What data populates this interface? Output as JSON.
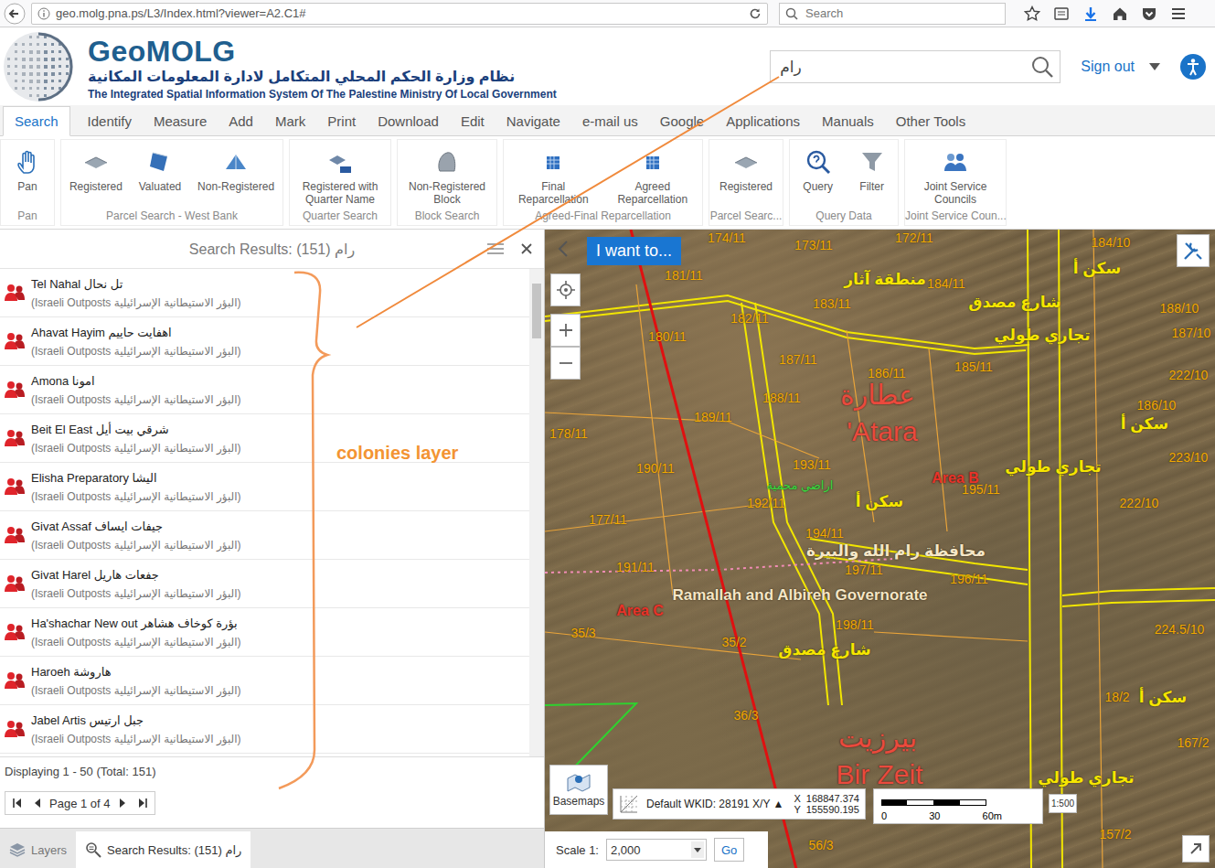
{
  "browser": {
    "url": "geo.molg.pna.ps/L3/Index.html?viewer=A2.C1#",
    "search_placeholder": "Search"
  },
  "header": {
    "logo_title": "GeoMOLG",
    "subtitle_ar": "نظام وزارة الحكم المحلي المتكامل لادارة المعلومات المكانية",
    "subtitle_en": "The Integrated Spatial Information System Of The Palestine Ministry Of Local Government",
    "search_value": "رام",
    "sign_out": "Sign out"
  },
  "tabs": [
    {
      "label": "Search",
      "selected": true
    },
    {
      "label": "Identify",
      "selected": false
    },
    {
      "label": "Measure",
      "selected": false
    },
    {
      "label": "Add",
      "selected": false
    },
    {
      "label": "Mark",
      "selected": false
    },
    {
      "label": "Print",
      "selected": false
    },
    {
      "label": "Download",
      "selected": false
    },
    {
      "label": "Edit",
      "selected": false
    },
    {
      "label": "Navigate",
      "selected": false
    },
    {
      "label": "e-mail us",
      "selected": false
    },
    {
      "label": "Google",
      "selected": false
    },
    {
      "label": "Applications",
      "selected": false
    },
    {
      "label": "Manuals",
      "selected": false
    },
    {
      "label": "Other Tools",
      "selected": false
    }
  ],
  "ribbon": [
    {
      "label": "Pan",
      "buttons": [
        "Pan"
      ]
    },
    {
      "label": "Parcel Search - West Bank",
      "buttons": [
        "Registered",
        "Valuated",
        "Non-Registered"
      ]
    },
    {
      "label": "Quarter Search",
      "buttons": [
        "Registered with Quarter Name"
      ]
    },
    {
      "label": "Block Search",
      "buttons": [
        "Non-Registered Block"
      ]
    },
    {
      "label": "Agreed-Final Reparcellation",
      "buttons": [
        "Final Reparcellation",
        "Agreed Reparcellation"
      ]
    },
    {
      "label": "Parcel Searc...",
      "buttons": [
        "Registered"
      ]
    },
    {
      "label": "Query Data",
      "buttons": [
        "Query",
        "Filter"
      ]
    },
    {
      "label": "Joint Service Coun...",
      "buttons": [
        "Joint Service Councils"
      ]
    }
  ],
  "results": {
    "title": "Search Results: (151) رام",
    "items": [
      {
        "name": "Tel Nahal تل نحال",
        "subtitle": "(Israeli Outposts   البؤر الاستيطانية الإسرائيلية)"
      },
      {
        "name": "Ahavat Hayim اهفايت حاييم",
        "subtitle": "(Israeli Outposts   البؤر الاستيطانية الإسرائيلية)"
      },
      {
        "name": "Amona امونا",
        "subtitle": "(Israeli Outposts   البؤر الاستيطانية الإسرائيلية)"
      },
      {
        "name": "Beit El East شرقي بيت أيل",
        "subtitle": "(Israeli Outposts   البؤر الاستيطانية الإسرائيلية)"
      },
      {
        "name": "Elisha Preparatory اليشا",
        "subtitle": "(Israeli Outposts   البؤر الاستيطانية الإسرائيلية)"
      },
      {
        "name": "Givat Assaf جيفات ايساف",
        "subtitle": "(Israeli Outposts   البؤر الاستيطانية الإسرائيلية)"
      },
      {
        "name": "Givat Harel جفعات هاريل",
        "subtitle": "(Israeli Outposts   البؤر الاستيطانية الإسرائيلية)"
      },
      {
        "name": "Ha'shachar New out بؤرة كوخاف هشاهر",
        "subtitle": "(Israeli Outposts   البؤر الاستيطانية الإسرائيلية)"
      },
      {
        "name": "Haroeh هاروشة",
        "subtitle": "(Israeli Outposts   البؤر الاستيطانية الإسرائيلية)"
      },
      {
        "name": "Jabel Artis جبل ارتيس",
        "subtitle": "(Israeli Outposts   البؤر الاستيطانية الإسرائيلية)"
      }
    ],
    "displaying": "Displaying 1 - 50 (Total: 151)",
    "page": "Page 1 of 4"
  },
  "bottom_tabs": [
    {
      "label": "Layers",
      "selected": false
    },
    {
      "label": "Search Results: (151) رام",
      "selected": true
    }
  ],
  "annotation": {
    "text": "colonies layer"
  },
  "map": {
    "i_want_to": "I want to...",
    "basemaps": "Basemaps",
    "wkid": "Default WKID: 28191 X/Y ▲",
    "x": "X  168847.374",
    "y": "Y  155590.195",
    "scale_ticks": [
      "0",
      "30",
      "60m"
    ],
    "mini_scale": "1:500",
    "scale_label": "Scale 1:",
    "scale_value": "2,000",
    "go": "Go",
    "labels": [
      {
        "text": "174/11",
        "kind": "parcel"
      },
      {
        "text": "173/11",
        "kind": "parcel"
      },
      {
        "text": "172/11",
        "kind": "parcel"
      },
      {
        "text": "184/10",
        "kind": "parcel"
      },
      {
        "text": "181/11",
        "kind": "parcel"
      },
      {
        "text": "منطقة آثار",
        "kind": "zone"
      },
      {
        "text": "184/11",
        "kind": "parcel"
      },
      {
        "text": "سكن أ",
        "kind": "zone"
      },
      {
        "text": "شارع مصدق",
        "kind": "zone"
      },
      {
        "text": "183/11",
        "kind": "parcel"
      },
      {
        "text": "182/11",
        "kind": "parcel"
      },
      {
        "text": "188/10",
        "kind": "parcel"
      },
      {
        "text": "180/11",
        "kind": "parcel"
      },
      {
        "text": "تجاري طولي",
        "kind": "zone"
      },
      {
        "text": "187/10",
        "kind": "parcel"
      },
      {
        "text": "187/11",
        "kind": "parcel"
      },
      {
        "text": "186/11",
        "kind": "parcel"
      },
      {
        "text": "185/11",
        "kind": "parcel"
      },
      {
        "text": "222/10",
        "kind": "parcel"
      },
      {
        "text": "عطارة",
        "kind": "place"
      },
      {
        "text": "188/11",
        "kind": "parcel"
      },
      {
        "text": "186/10",
        "kind": "parcel"
      },
      {
        "text": "189/11",
        "kind": "parcel"
      },
      {
        "text": "سكن أ",
        "kind": "zone"
      },
      {
        "text": "'Atara",
        "kind": "place"
      },
      {
        "text": "178/11",
        "kind": "parcel"
      },
      {
        "text": "223/10",
        "kind": "parcel"
      },
      {
        "text": "تجاري طولي",
        "kind": "zone"
      },
      {
        "text": "193/11",
        "kind": "parcel"
      },
      {
        "text": "190/11",
        "kind": "parcel"
      },
      {
        "text": "Area B",
        "kind": "area"
      },
      {
        "text": "195/11",
        "kind": "parcel"
      },
      {
        "text": "اراضي محمية",
        "kind": "protected"
      },
      {
        "text": "192/11",
        "kind": "parcel"
      },
      {
        "text": "سكن أ",
        "kind": "zone"
      },
      {
        "text": "222/10",
        "kind": "parcel"
      },
      {
        "text": "177/11",
        "kind": "parcel"
      },
      {
        "text": "194/11",
        "kind": "parcel"
      },
      {
        "text": "محافظة رام الله والبيرة",
        "kind": "governorate"
      },
      {
        "text": "191/11",
        "kind": "parcel"
      },
      {
        "text": "197/11",
        "kind": "parcel"
      },
      {
        "text": "196/11",
        "kind": "parcel"
      },
      {
        "text": "Ramallah and Albireh Governorate",
        "kind": "governorate"
      },
      {
        "text": "Area C",
        "kind": "area"
      },
      {
        "text": "198/11",
        "kind": "parcel"
      },
      {
        "text": "35/3",
        "kind": "parcel"
      },
      {
        "text": "شارع مصدق",
        "kind": "zone"
      },
      {
        "text": "35/2",
        "kind": "parcel"
      },
      {
        "text": "224.5/10",
        "kind": "parcel"
      },
      {
        "text": "18/2",
        "kind": "parcel"
      },
      {
        "text": "سكن أ",
        "kind": "zone"
      },
      {
        "text": "36/3",
        "kind": "parcel"
      },
      {
        "text": "بيرزيت",
        "kind": "place"
      },
      {
        "text": "167/2",
        "kind": "parcel"
      },
      {
        "text": "Bir Zeit",
        "kind": "place"
      },
      {
        "text": "تجاري طولي",
        "kind": "zone"
      },
      {
        "text": "56/3",
        "kind": "parcel"
      },
      {
        "text": "157/2",
        "kind": "parcel"
      }
    ]
  }
}
